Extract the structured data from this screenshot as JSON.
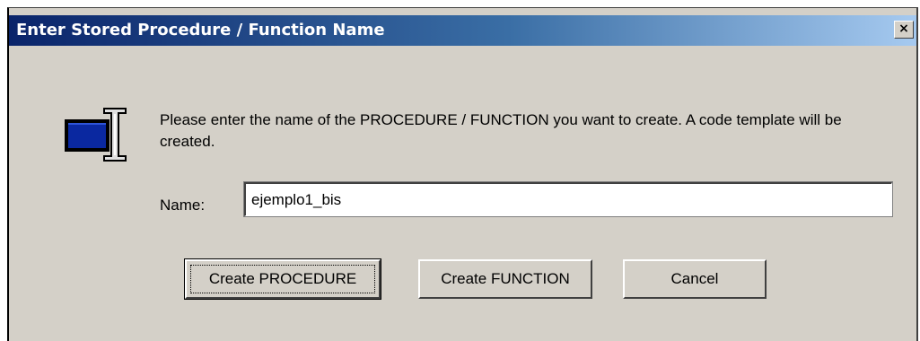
{
  "window": {
    "title": "Enter Stored Procedure / Function Name",
    "close_symbol": "×"
  },
  "icon": "text-cursor-window-icon",
  "message": "Please enter the name of the PROCEDURE / FUNCTION you want to create. A code template will be created.",
  "form": {
    "name_label": "Name:",
    "name_value": "ejemplo1_bis"
  },
  "buttons": {
    "create_procedure": "Create PROCEDURE",
    "create_function": "Create FUNCTION",
    "cancel": "Cancel"
  },
  "colors": {
    "titlebar_start": "#0a246a",
    "titlebar_end": "#a6caf0",
    "dialog_face": "#d4d0c8",
    "icon_blue": "#0a28a0"
  }
}
